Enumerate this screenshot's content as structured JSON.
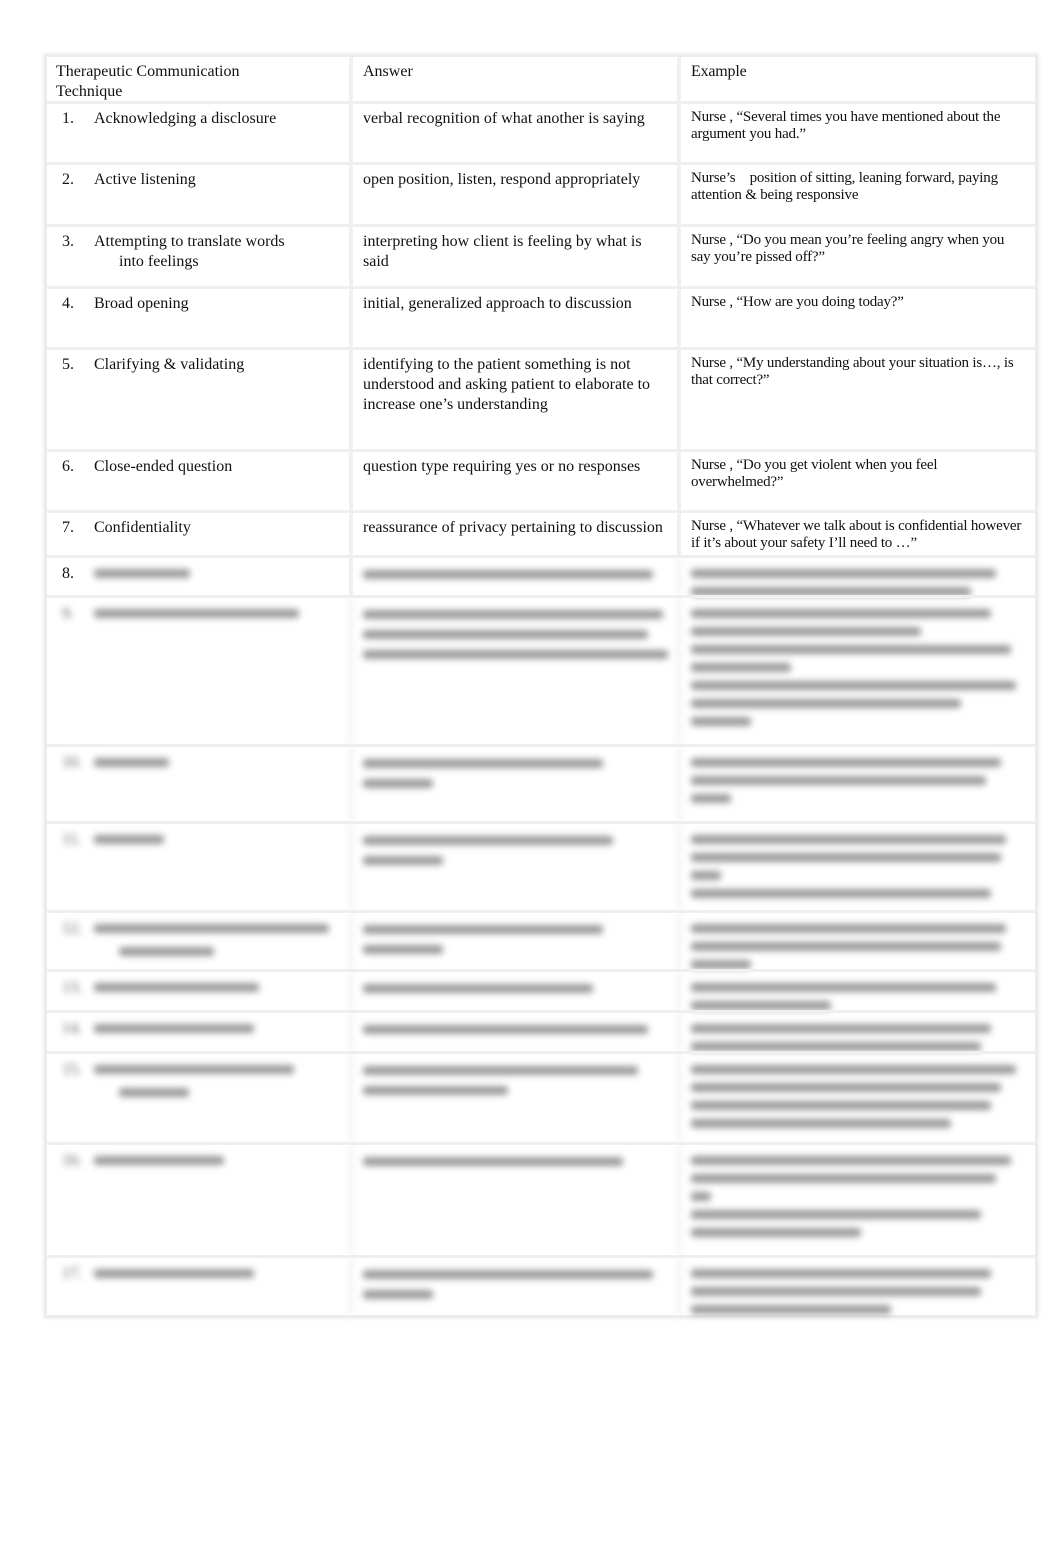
{
  "document": {
    "headers": {
      "technique": "Therapeutic Communication Technique",
      "technique_line1": "Therapeutic Communication",
      "technique_line2": "Technique",
      "answer": "Answer",
      "example": "Example"
    },
    "rows": [
      {
        "num": "1.",
        "technique": "Acknowledging a disclosure",
        "answer": "verbal recognition of what another is saying",
        "example": "Nurse , “Several times you have mentioned about the argument you had.”"
      },
      {
        "num": "2.",
        "technique": "Active listening",
        "answer": "open position, listen, respond appropriately",
        "example": "Nurse’s    position of sitting, leaning forward, paying attention & being responsive"
      },
      {
        "num": "3.",
        "technique": "Attempting to translate words",
        "technique_cont": "into feelings",
        "answer": "interpreting how client is feeling by what is said",
        "example": "Nurse , “Do you mean you’re feeling angry when you say you’re pissed off?”"
      },
      {
        "num": "4.",
        "technique": "Broad opening",
        "answer": "initial, generalized approach to discussion",
        "example": "Nurse , “How are you doing today?”"
      },
      {
        "num": "5.",
        "technique": "Clarifying & validating",
        "answer": "identifying to the patient something is not understood and asking patient to elaborate to increase one’s understanding",
        "example": "Nurse , “My understanding about your situation is…, is that correct?”"
      },
      {
        "num": "6.",
        "technique": "Close-ended question",
        "answer": "question type requiring yes or no responses",
        "example": "Nurse , “Do you get violent when you feel overwhelmed?”"
      },
      {
        "num": "7.",
        "technique": "Confidentiality",
        "answer": "reassurance of privacy pertaining to discussion",
        "example": "Nurse , “Whatever we talk about is confidential however if it’s about your safety I’ll need to …”"
      }
    ],
    "blurred_rows": [
      {
        "num": "8."
      },
      {
        "num": "9."
      },
      {
        "num": "10."
      },
      {
        "num": "11."
      },
      {
        "num": "12."
      },
      {
        "num": "13."
      },
      {
        "num": "14."
      },
      {
        "num": "15."
      },
      {
        "num": "16."
      },
      {
        "num": "17."
      }
    ]
  }
}
